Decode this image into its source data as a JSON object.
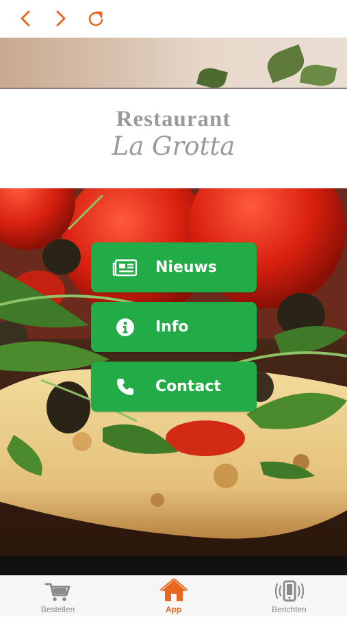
{
  "nav": {
    "back_icon": "chevron-left-icon",
    "forward_icon": "chevron-right-icon",
    "refresh_icon": "refresh-icon",
    "accent": "#e8671f"
  },
  "header": {
    "title_line1": "Restaurant",
    "title_line2": "La Grotta"
  },
  "menu": {
    "button_color": "#23ab47",
    "items": [
      {
        "label": "Nieuws",
        "icon": "newspaper-icon"
      },
      {
        "label": "Info",
        "icon": "info-icon"
      },
      {
        "label": "Contact",
        "icon": "phone-icon"
      }
    ]
  },
  "tabs": [
    {
      "label": "Bestellen",
      "icon": "cart-icon",
      "active": false
    },
    {
      "label": "App",
      "icon": "home-icon",
      "active": true
    },
    {
      "label": "Berichten",
      "icon": "phone-vibrate-icon",
      "active": false
    }
  ]
}
